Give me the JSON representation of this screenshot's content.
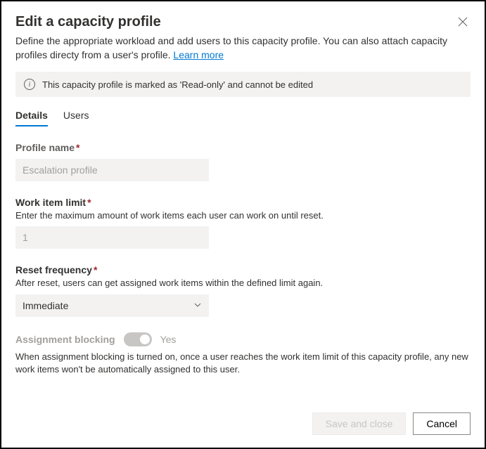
{
  "header": {
    "title": "Edit a capacity profile",
    "subtitle_part1": "Define the appropriate workload and add users to this capacity profile. You can also attach capacity profiles directy from a user's profile. ",
    "learn_more": "Learn more"
  },
  "info_bar": {
    "text": "This capacity profile is marked as 'Read-only' and cannot be edited"
  },
  "tabs": {
    "details": "Details",
    "users": "Users"
  },
  "fields": {
    "profile_name": {
      "label": "Profile name",
      "value": "Escalation profile"
    },
    "work_item_limit": {
      "label": "Work item limit",
      "helper": "Enter the maximum amount of work items each user can work on until reset.",
      "value": "1"
    },
    "reset_frequency": {
      "label": "Reset frequency",
      "helper": "After reset, users can get assigned work items within the defined limit again.",
      "value": "Immediate"
    },
    "assignment_blocking": {
      "label": "Assignment blocking",
      "state": "Yes",
      "helper": "When assignment blocking is turned on, once a user reaches the work item limit of this capacity profile, any new work items won't be automatically assigned to this user."
    }
  },
  "footer": {
    "save": "Save and close",
    "cancel": "Cancel"
  },
  "required_marker": "*"
}
